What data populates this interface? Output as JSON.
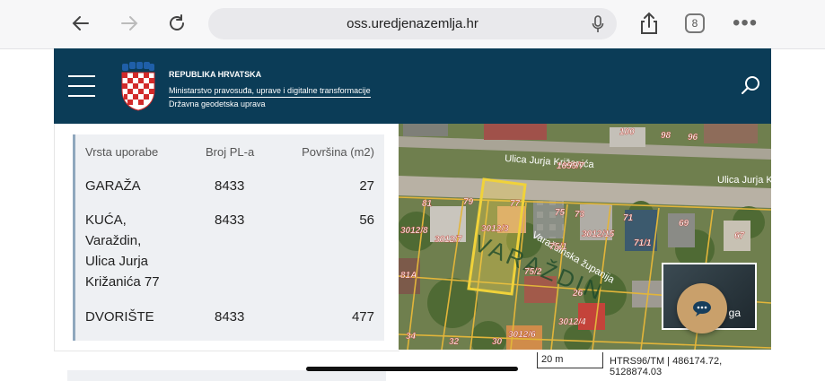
{
  "browser": {
    "url": "oss.uredjenazemlja.hr",
    "tab_count": "8"
  },
  "header": {
    "org_line1": "REPUBLIKA HRVATSKA",
    "org_line2": "Ministarstvo pravosuđa, uprave i digitalne transformacije",
    "org_line3": "Državna geodetska uprava"
  },
  "table": {
    "columns": [
      "Vrsta uporabe",
      "Broj PL-a",
      "Površina (m2)"
    ],
    "rows": [
      {
        "vrsta": "GARAŽA",
        "broj": "8433",
        "povrsina": "27"
      },
      {
        "vrsta_lines": [
          "KUĆA,",
          "Varaždin,",
          "Ulica Jurja",
          "Križanića 77"
        ],
        "broj": "8433",
        "povrsina": "56"
      },
      {
        "vrsta": "DVORIŠTE",
        "broj": "8433",
        "povrsina": "477"
      }
    ]
  },
  "map": {
    "street_labels": [
      "Ulica Jurja Križanića",
      "Ulica Jurja K",
      "Varaždinska županija",
      "VARAŽDIN"
    ],
    "parcel_labels": [
      "100",
      "98",
      "96",
      "79",
      "77",
      "75",
      "73",
      "71",
      "69",
      "67",
      "71/1",
      "75/1",
      "75/2",
      "26",
      "30",
      "32",
      "34",
      "81",
      "81A",
      "3012/8",
      "3012/7",
      "3012/15",
      "3012/4",
      "3012/6",
      "3012/3",
      "1655/7"
    ],
    "scale_label": "20 m",
    "coordinates": "HTRS96/TM | 486174.72, 5128874.03",
    "thumbnail_label": "ga",
    "colors": {
      "parcel_border": "#e2b53a",
      "label_red": "#b33a2e",
      "selected_fill": "#f2d24a"
    }
  }
}
